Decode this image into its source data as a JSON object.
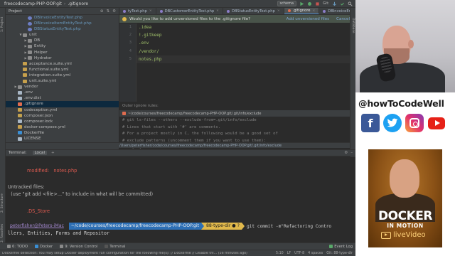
{
  "titlebar": {
    "project": "freecodecamp-PHP-OOP.git",
    "file": ".gitignore",
    "run_config": "schema",
    "git_label": "Git:"
  },
  "left_strip": {
    "project_label": "1: Project",
    "structure_label": "2: Structure",
    "favorites_label": "2: Favorites"
  },
  "project_panel": {
    "header": "Project",
    "tree": [
      {
        "indent": 3,
        "arrow": "",
        "icon": "php",
        "label": "DBInvoiceEntityTest.php",
        "blue": true
      },
      {
        "indent": 3,
        "arrow": "",
        "icon": "php",
        "label": "DBInvoiceItemEntityTest.php",
        "blue": true
      },
      {
        "indent": 3,
        "arrow": "",
        "icon": "php",
        "label": "DBStatusEntityTest.php",
        "blue": true
      },
      {
        "indent": 2,
        "arrow": "▼",
        "icon": "folder",
        "label": "unit"
      },
      {
        "indent": 3,
        "arrow": "▶",
        "icon": "folder",
        "label": "DB"
      },
      {
        "indent": 3,
        "arrow": "▶",
        "icon": "folder",
        "label": "Entity"
      },
      {
        "indent": 3,
        "arrow": "▶",
        "icon": "folder",
        "label": "Helper"
      },
      {
        "indent": 3,
        "arrow": "▶",
        "icon": "folder",
        "label": "Hydrator"
      },
      {
        "indent": 2,
        "arrow": "",
        "icon": "yml",
        "label": "acceptance.suite.yml"
      },
      {
        "indent": 2,
        "arrow": "",
        "icon": "yml",
        "label": "functional.suite.yml"
      },
      {
        "indent": 2,
        "arrow": "",
        "icon": "yml",
        "label": "integration.suite.yml"
      },
      {
        "indent": 2,
        "arrow": "",
        "icon": "yml",
        "label": "unit.suite.yml"
      },
      {
        "indent": 1,
        "arrow": "▶",
        "icon": "folder",
        "label": "vendor"
      },
      {
        "indent": 1,
        "arrow": "",
        "icon": "file",
        "label": ".env"
      },
      {
        "indent": 1,
        "arrow": "",
        "icon": "file",
        "label": ".env.dist"
      },
      {
        "indent": 1,
        "arrow": "",
        "icon": "git",
        "label": ".gitignore",
        "selected": true
      },
      {
        "indent": 1,
        "arrow": "",
        "icon": "yml",
        "label": "codeception.yml"
      },
      {
        "indent": 1,
        "arrow": "",
        "icon": "json",
        "label": "composer.json"
      },
      {
        "indent": 1,
        "arrow": "",
        "icon": "file",
        "label": "composer.lock"
      },
      {
        "indent": 1,
        "arrow": "",
        "icon": "yml",
        "label": "docker-compose.yml"
      },
      {
        "indent": 1,
        "arrow": "",
        "icon": "docker",
        "label": "Dockerfile"
      },
      {
        "indent": 1,
        "arrow": "",
        "icon": "file",
        "label": "LICENSE"
      }
    ]
  },
  "tabs": [
    {
      "label": "tyTest.php",
      "icon": "php",
      "active": false
    },
    {
      "label": "DBCustomerEntityTest.php",
      "icon": "php",
      "active": false
    },
    {
      "label": "DBStatusEntityTest.php",
      "icon": "php",
      "active": false
    },
    {
      "label": ".gitignore",
      "icon": "git",
      "active": true
    },
    {
      "label": "DBInvoiceEntityTest.php",
      "icon": "php",
      "active": false
    },
    {
      "label": "8»",
      "icon": "",
      "active": false
    }
  ],
  "banner": {
    "message": "Would you like to add unversioned files to the .gitignore file?",
    "add_label": "Add unversioned files",
    "cancel_label": "Cancel"
  },
  "editor": {
    "lines": [
      {
        "n": "1",
        "text": ".idea"
      },
      {
        "n": "2",
        "text": "!.gitkeep"
      },
      {
        "n": "3",
        "text": ".env"
      },
      {
        "n": "4",
        "text": "/vendor/"
      },
      {
        "n": "5",
        "text": "notes.php"
      }
    ],
    "outer_label": "Outer ignore rules:",
    "outer_path": "~/code/courses/freecodecamp/freecodecamp-PHP-OOP.git/.git/info/exclude",
    "outer_lines": [
      "# git ls-files --others --exclude-from=.git/info/exclude",
      "# Lines that start with '#' are comments.",
      "# For a project mostly in C, the following would be a good set of",
      "# exclude patterns (uncomment them if you want to use them):",
      "# *.[oa]"
    ],
    "crumb": "/Users/peterfisher/code/courses/freecodecamp/freecodecamp-PHP-OOP.git/.git/info/exclude"
  },
  "terminal": {
    "title": "Terminal:",
    "tab": "Local",
    "modified_label": "modified:   notes.php",
    "untracked": "Untracked files:",
    "hint": "  (use \"git add <file>...\" to include in what will be committed)",
    "ds_store": ".DS_Store",
    "prompt_user": "peterfisher@Peters-iMac",
    "prompt_path": "~/code/courses/freecodecamp/freecodecamp-PHP-OOP.git",
    "prompt_branch": "88-type-dir ● ?",
    "command": "git commit -m\"Refactoring Contro",
    "command_wrap": "llers, Entities, Forms and Repositor"
  },
  "bottom_tools": {
    "todo": "6: TODO",
    "docker": "Docker",
    "vcs": "9: Version Control",
    "terminal": "Terminal",
    "event_log": "Event Log"
  },
  "status": {
    "message": "Dockerfile detection: You may setup Docker deployment run configuration for the following file(s): // Dockerfile // Disable thi... (56 minutes ago)",
    "pos": "5:10",
    "lf": "LF",
    "enc": "UTF-8",
    "indent": "4 spaces",
    "git": "Git: 88-type-dir"
  },
  "brand": {
    "handle": "@howToCodeWell",
    "cover_title": "DOCKER",
    "cover_sub": "IN MOTION",
    "cover_live": "liveVideo"
  },
  "colors": {
    "accent": "#4a88c7",
    "ide_bg": "#2b2b2b",
    "panel_bg": "#3c3f41",
    "ignored_text": "#a0c06a",
    "terminal_red": "#dd5a4f",
    "prompt_path_bg": "#2d6fb5",
    "prompt_branch_bg": "#e0b84b"
  }
}
